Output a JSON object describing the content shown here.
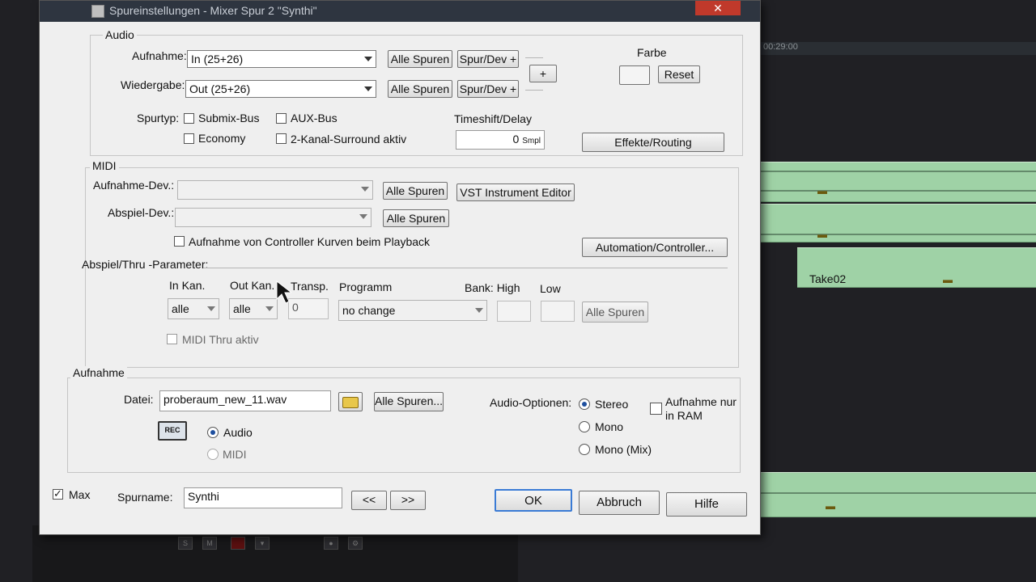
{
  "dialog": {
    "title": "Spureinstellungen - Mixer Spur 2 \"Synthi\"",
    "close_label": "✕"
  },
  "audio": {
    "group_label": "Audio",
    "aufnahme_label": "Aufnahme:",
    "aufnahme_value": "In (25+26)",
    "wiedergabe_label": "Wiedergabe:",
    "wiedergabe_value": "Out (25+26)",
    "alle_spuren": "Alle Spuren",
    "spur_dev": "Spur/Dev +",
    "plus": "+",
    "farbe_label": "Farbe",
    "reset": "Reset",
    "spurtyp_label": "Spurtyp:",
    "submix_bus": "Submix-Bus",
    "aux_bus": "AUX-Bus",
    "economy": "Economy",
    "surround": "2-Kanal-Surround aktiv",
    "timeshift_label": "Timeshift/Delay",
    "timeshift_value": "0",
    "timeshift_unit": "Smpl",
    "effekte_routing": "Effekte/Routing"
  },
  "midi": {
    "group_label": "MIDI",
    "aufnahme_dev_label": "Aufnahme-Dev.:",
    "abspiel_dev_label": "Abspiel-Dev.:",
    "alle_spuren": "Alle Spuren",
    "vst_editor": "VST Instrument Editor",
    "controller_kurven": "Aufnahme von Controller Kurven beim Playback",
    "automation": "Automation/Controller...",
    "params_label": "Abspiel/Thru -Parameter:",
    "in_kan_label": "In Kan.",
    "in_kan_value": "alle",
    "out_kan_label": "Out Kan.",
    "out_kan_value": "alle",
    "transp_label": "Transp.",
    "transp_value": "0",
    "programm_label": "Programm",
    "programm_value": "no change",
    "bank_high_label": "Bank: High",
    "low_label": "Low",
    "alle_spuren_2": "Alle Spuren",
    "midi_thru": "MIDI Thru aktiv"
  },
  "record": {
    "group_label": "Aufnahme",
    "datei_label": "Datei:",
    "datei_value": "proberaum_new_11.wav",
    "alle_spuren": "Alle Spuren...",
    "rec": "REC",
    "audio": "Audio",
    "midi": "MIDI",
    "audio_optionen_label": "Audio-Optionen:",
    "stereo": "Stereo",
    "mono": "Mono",
    "mono_mix": "Mono (Mix)",
    "ram_label": "Aufnahme nur in RAM"
  },
  "footer": {
    "max": "Max",
    "spurname_label": "Spurname:",
    "spurname_value": "Synthi",
    "prev": "<<",
    "next": ">>",
    "ok": "OK",
    "abbruch": "Abbruch",
    "hilfe": "Hilfe"
  },
  "daw": {
    "take_label": "Take02",
    "time_readout": "00:29:00"
  },
  "colors": {
    "track_green": "#9fd2a6",
    "titlebar": "#2e3540",
    "dialog_bg": "#efefef"
  }
}
